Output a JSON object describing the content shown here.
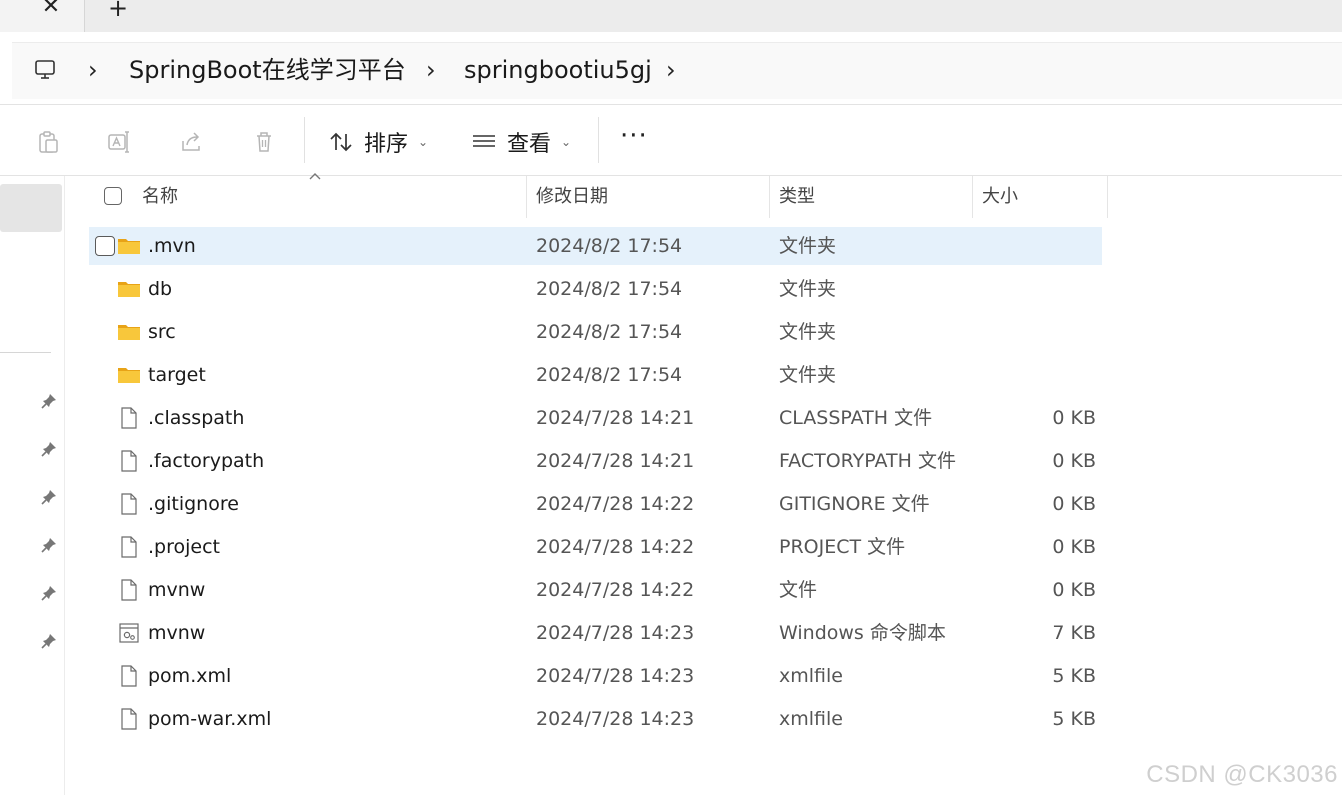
{
  "window": {
    "tab_close_glyph": "✕",
    "tab_new_glyph": "+"
  },
  "address_bar": {
    "root_icon": "computer-icon",
    "separator": "›",
    "crumbs": [
      "SpringBoot在线学习平台",
      "springbootiu5gj"
    ]
  },
  "toolbar": {
    "disabled_icons": [
      "paste-icon",
      "rename-icon",
      "share-icon",
      "delete-icon"
    ],
    "sort_label": "排序",
    "view_label": "查看",
    "more_label": "···"
  },
  "columns": {
    "name": "名称",
    "modified": "修改日期",
    "type": "类型",
    "size": "大小"
  },
  "files": [
    {
      "name": ".mvn",
      "modified": "2024/8/2 17:54",
      "type": "文件夹",
      "size": "",
      "icon": "folder-icon",
      "selected": true
    },
    {
      "name": "db",
      "modified": "2024/8/2 17:54",
      "type": "文件夹",
      "size": "",
      "icon": "folder-icon"
    },
    {
      "name": "src",
      "modified": "2024/8/2 17:54",
      "type": "文件夹",
      "size": "",
      "icon": "folder-icon"
    },
    {
      "name": "target",
      "modified": "2024/8/2 17:54",
      "type": "文件夹",
      "size": "",
      "icon": "folder-icon"
    },
    {
      "name": ".classpath",
      "modified": "2024/7/28 14:21",
      "type": "CLASSPATH 文件",
      "size": "0 KB",
      "icon": "file-icon"
    },
    {
      "name": ".factorypath",
      "modified": "2024/7/28 14:21",
      "type": "FACTORYPATH 文件",
      "size": "0 KB",
      "icon": "file-icon"
    },
    {
      "name": ".gitignore",
      "modified": "2024/7/28 14:22",
      "type": "GITIGNORE 文件",
      "size": "0 KB",
      "icon": "file-icon"
    },
    {
      "name": ".project",
      "modified": "2024/7/28 14:22",
      "type": "PROJECT 文件",
      "size": "0 KB",
      "icon": "file-icon"
    },
    {
      "name": "mvnw",
      "modified": "2024/7/28 14:22",
      "type": "文件",
      "size": "0 KB",
      "icon": "file-icon"
    },
    {
      "name": "mvnw",
      "modified": "2024/7/28 14:23",
      "type": "Windows 命令脚本",
      "size": "7 KB",
      "icon": "script-file-icon"
    },
    {
      "name": "pom.xml",
      "modified": "2024/7/28 14:23",
      "type": "xmlfile",
      "size": "5 KB",
      "icon": "file-icon"
    },
    {
      "name": "pom-war.xml",
      "modified": "2024/7/28 14:23",
      "type": "xmlfile",
      "size": "5 KB",
      "icon": "file-icon"
    }
  ],
  "watermark": "CSDN @CK3036",
  "colors": {
    "selected_row": "#e5f1fb",
    "folder": "#f8c73b",
    "folder_dark": "#e8a317",
    "sidebar_selected": "#e5e5e5"
  }
}
